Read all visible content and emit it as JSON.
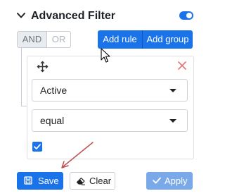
{
  "header": {
    "title": "Advanced Filter",
    "toggle_on": true
  },
  "logic": {
    "and_label": "AND",
    "or_label": "OR",
    "selected": "AND"
  },
  "actions": {
    "add_rule_label": "Add rule",
    "add_group_label": "Add group"
  },
  "rule": {
    "field_value": "Active",
    "operator_value": "equal",
    "checkbox_checked": true
  },
  "footer": {
    "save_label": "Save",
    "clear_label": "Clear",
    "apply_label": "Apply"
  },
  "colors": {
    "accent": "#1a73e8",
    "apply_disabled": "#7aa9ea",
    "remove_icon": "#e57373",
    "annotation_arrow": "#c0504d"
  },
  "icons": [
    "chevron-down-icon",
    "move-icon",
    "close-icon",
    "save-icon",
    "eraser-icon",
    "check-icon"
  ]
}
